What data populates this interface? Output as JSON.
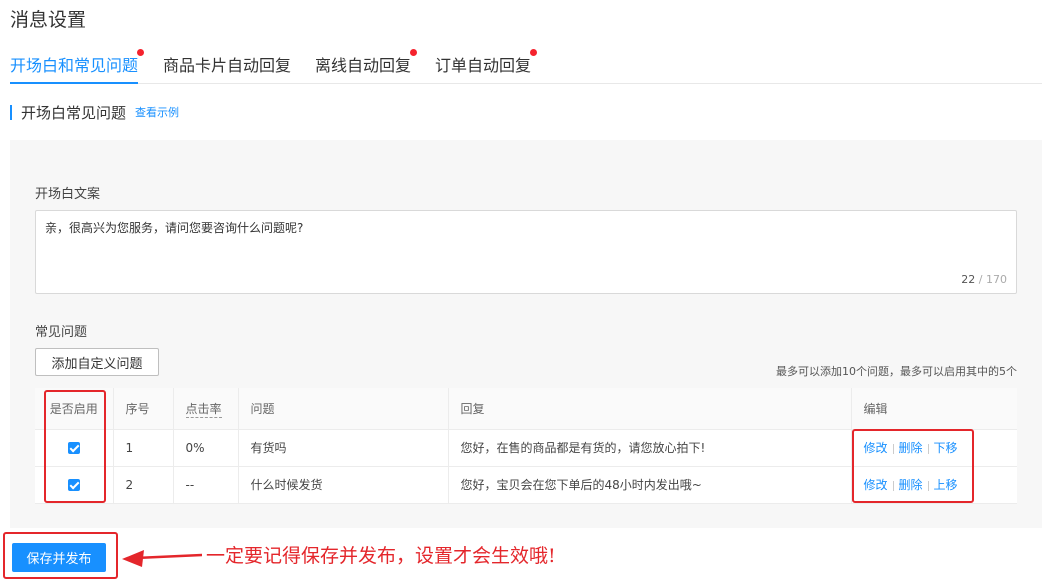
{
  "page": {
    "title": "消息设置"
  },
  "tabs": [
    {
      "label": "开场白和常见问题",
      "active": true,
      "dot": true
    },
    {
      "label": "商品卡片自动回复",
      "active": false,
      "dot": false
    },
    {
      "label": "离线自动回复",
      "active": false,
      "dot": true
    },
    {
      "label": "订单自动回复",
      "active": false,
      "dot": true
    }
  ],
  "section": {
    "title": "开场白常见问题",
    "example_link": "查看示例"
  },
  "opening": {
    "label": "开场白文案",
    "text": "亲，很高兴为您服务，请问您要咨询什么问题呢?",
    "count": "22",
    "max": "/ 170"
  },
  "faq": {
    "label": "常见问题",
    "add_button": "添加自定义问题",
    "limit_note": "最多可以添加10个问题，最多可以启用其中的5个",
    "columns": {
      "enable": "是否启用",
      "index": "序号",
      "ctr": "点击率",
      "question": "问题",
      "reply": "回复",
      "edit": "编辑"
    },
    "rows": [
      {
        "enabled": true,
        "index": "1",
        "ctr": "0%",
        "question": "有货吗",
        "reply": "您好，在售的商品都是有货的，请您放心拍下!",
        "actions": [
          "修改",
          "删除",
          "下移"
        ]
      },
      {
        "enabled": true,
        "index": "2",
        "ctr": "--",
        "question": "什么时候发货",
        "reply": "您好，宝贝会在您下单后的48小时内发出哦~",
        "actions": [
          "修改",
          "删除",
          "上移"
        ]
      }
    ]
  },
  "footer": {
    "save_button": "保存并发布",
    "annotation": "一定要记得保存并发布，设置才会生效哦!"
  },
  "colors": {
    "accent": "#1890ff",
    "highlight": "#e4262b",
    "dot": "#f5222d"
  }
}
